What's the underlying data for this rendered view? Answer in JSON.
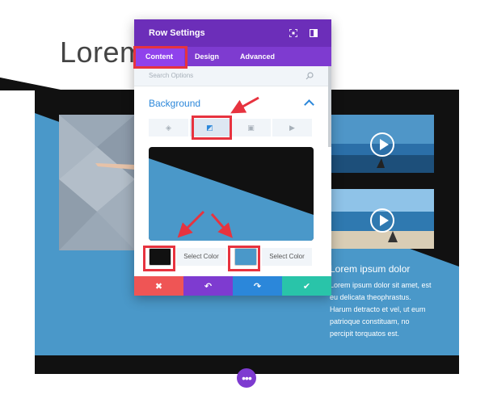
{
  "page": {
    "heading": "Lorem",
    "side_title": "Lorem ipsum dolor",
    "side_body_lines": [
      "Lorem ipsum dolor sit amet, est",
      "eu delicata theophrastus.",
      "Harum detracto et vel, ut eum",
      "patrioque constituam, no",
      "percipit torquatos est."
    ]
  },
  "modal": {
    "title": "Row Settings",
    "header_icons": [
      "expand-icon",
      "sidebar-toggle-icon"
    ],
    "tabs": [
      {
        "label": "Content",
        "active": true
      },
      {
        "label": "Design",
        "active": false
      },
      {
        "label": "Advanced",
        "active": false
      }
    ],
    "search_placeholder": "Search Options",
    "section_title": "Background",
    "background_types": [
      {
        "icon": "color-fill-icon",
        "glyph": "◈",
        "selected": false
      },
      {
        "icon": "gradient-icon",
        "glyph": "◩",
        "selected": true
      },
      {
        "icon": "image-icon",
        "glyph": "▣",
        "selected": false
      },
      {
        "icon": "video-icon",
        "glyph": "▶",
        "selected": false
      }
    ],
    "gradient_start": {
      "label": "Select Color",
      "color": "#111111"
    },
    "gradient_end": {
      "label": "Select Color",
      "color": "#4a98c9"
    },
    "footer_buttons": [
      {
        "name": "cancel-button",
        "glyph": "✖",
        "color": "#ef5555"
      },
      {
        "name": "undo-button",
        "glyph": "↶",
        "color": "#7e3bd0"
      },
      {
        "name": "redo-button",
        "glyph": "↷",
        "color": "#2b87da"
      },
      {
        "name": "save-button",
        "glyph": "✔",
        "color": "#29c4a9"
      }
    ]
  },
  "colors": {
    "accent_purple": "#6c2eb9",
    "callout_red": "#e7333f",
    "section_blue": "#4a98c9",
    "section_dark": "#111111"
  }
}
